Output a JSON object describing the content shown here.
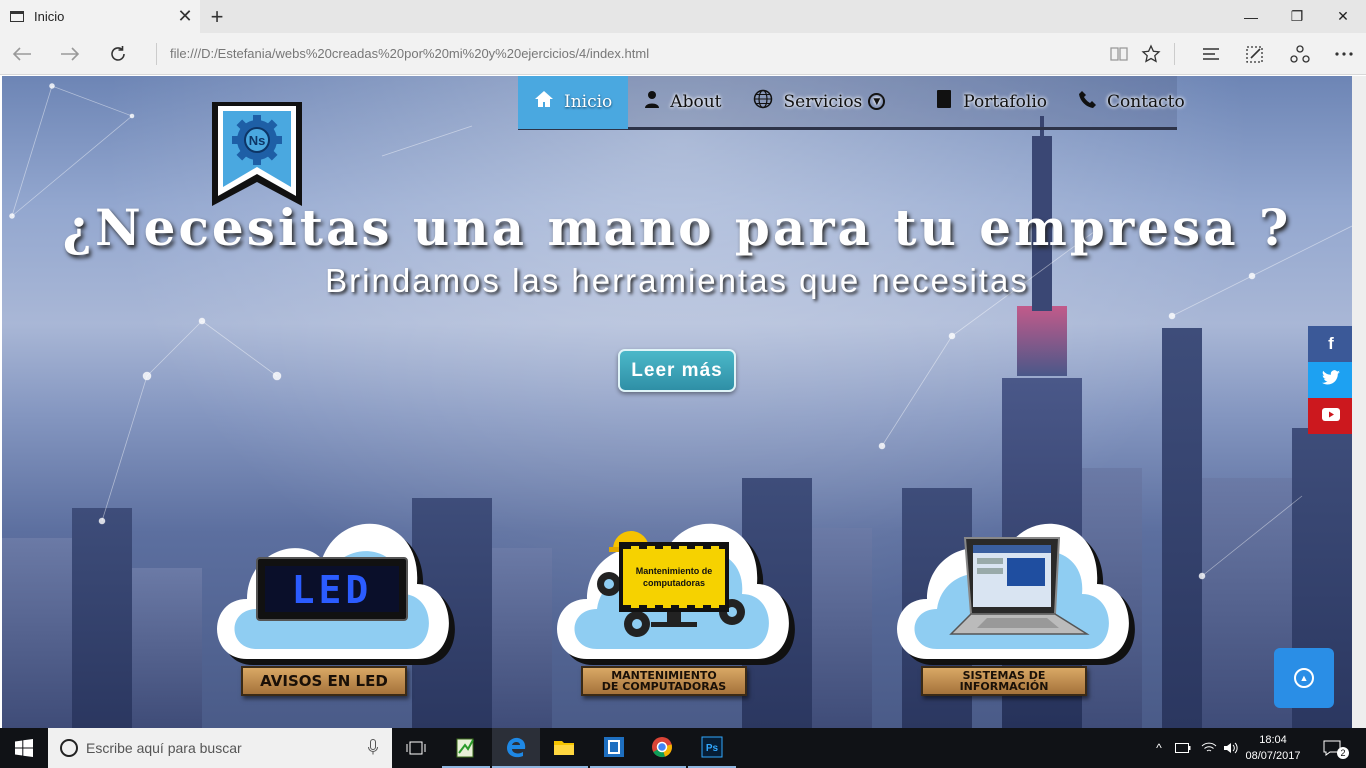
{
  "browser": {
    "tab_title": "Inicio",
    "tab_close": "✕",
    "new_tab": "+",
    "url": "file:///D:/Estefania/webs%20creadas%20por%20mi%20y%20ejercicios/4/index.html",
    "window": {
      "minimize": "—",
      "restore": "❐",
      "close": "✕"
    },
    "icons": [
      "back-icon",
      "forward-icon",
      "refresh-icon",
      "reading-view-icon",
      "favorite-star-icon",
      "hub-icon",
      "web-note-icon",
      "share-icon",
      "more-icon"
    ]
  },
  "site": {
    "nav": [
      {
        "label": "Inicio",
        "icon": "home-icon",
        "active": true
      },
      {
        "label": "About",
        "icon": "person-icon",
        "active": false
      },
      {
        "label": "Servicios",
        "icon": "globe-icon",
        "active": false
      },
      {
        "label": "Portafolio",
        "icon": "book-icon",
        "active": false
      },
      {
        "label": "Contacto",
        "icon": "phone-icon",
        "active": false
      }
    ],
    "logo_text": "Ns",
    "headline": "¿Necesitas una mano para tu empresa ?",
    "subheadline": "Brindamos las herramientas que necesitas",
    "cta_label": "Leer más",
    "services": [
      {
        "image_text": "LED",
        "plank_line1": "AVISOS EN LED",
        "plank_line2": ""
      },
      {
        "image_text_1": "Mantenimiento de",
        "image_text_2": "computadoras",
        "plank_line1": "MANTENIMIENTO",
        "plank_line2": "DE COMPUTADORAS"
      },
      {
        "plank_line1": "SISTEMAS DE",
        "plank_line2": "INFORMACIÓN"
      }
    ],
    "social": [
      {
        "name": "facebook",
        "glyph": "f",
        "color": "#3b5998"
      },
      {
        "name": "twitter",
        "glyph": "🐦",
        "color": "#1da1f2"
      },
      {
        "name": "youtube",
        "glyph": "▶",
        "color": "#cc181e"
      }
    ]
  },
  "taskbar": {
    "search_placeholder": "Escribe aquí para buscar",
    "time": "18:04",
    "date": "08/07/2017",
    "notifications": "2"
  }
}
